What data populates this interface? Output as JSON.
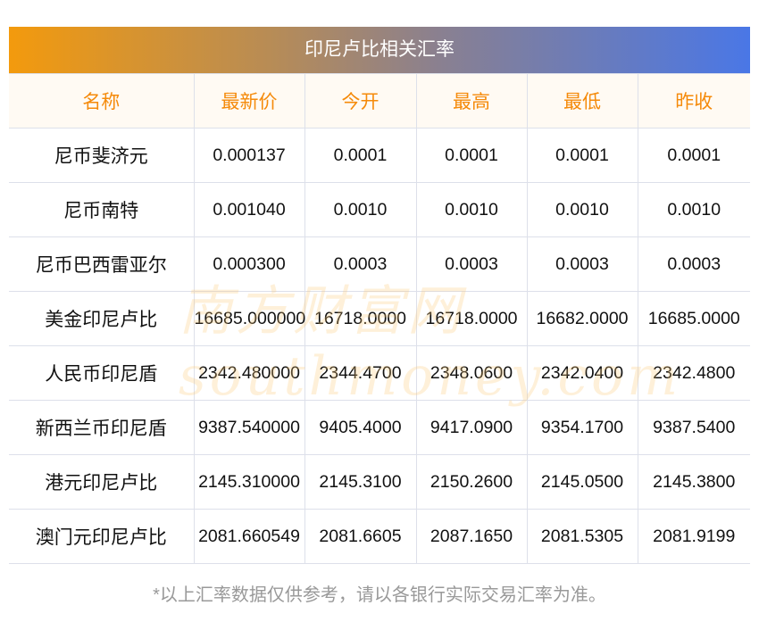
{
  "title": "印尼卢比相关汇率",
  "columns": [
    "名称",
    "最新价",
    "今开",
    "最高",
    "最低",
    "昨收"
  ],
  "rows": [
    [
      "尼币斐济元",
      "0.000137",
      "0.0001",
      "0.0001",
      "0.0001",
      "0.0001"
    ],
    [
      "尼币南特",
      "0.001040",
      "0.0010",
      "0.0010",
      "0.0010",
      "0.0010"
    ],
    [
      "尼币巴西雷亚尔",
      "0.000300",
      "0.0003",
      "0.0003",
      "0.0003",
      "0.0003"
    ],
    [
      "美金印尼卢比",
      "16685.000000",
      "16718.0000",
      "16718.0000",
      "16682.0000",
      "16685.0000"
    ],
    [
      "人民币印尼盾",
      "2342.480000",
      "2344.4700",
      "2348.0600",
      "2342.0400",
      "2342.4800"
    ],
    [
      "新西兰币印尼盾",
      "9387.540000",
      "9405.4000",
      "9417.0900",
      "9354.1700",
      "9387.5400"
    ],
    [
      "港元印尼卢比",
      "2145.310000",
      "2145.3100",
      "2150.2600",
      "2145.0500",
      "2145.3800"
    ],
    [
      "澳门元印尼卢比",
      "2081.660549",
      "2081.6605",
      "2087.1650",
      "2081.5305",
      "2081.9199"
    ]
  ],
  "watermark": "southmoney.com 南方财富网",
  "footer": "*以上汇率数据仅供参考，请以各银行实际交易汇率为准。"
}
